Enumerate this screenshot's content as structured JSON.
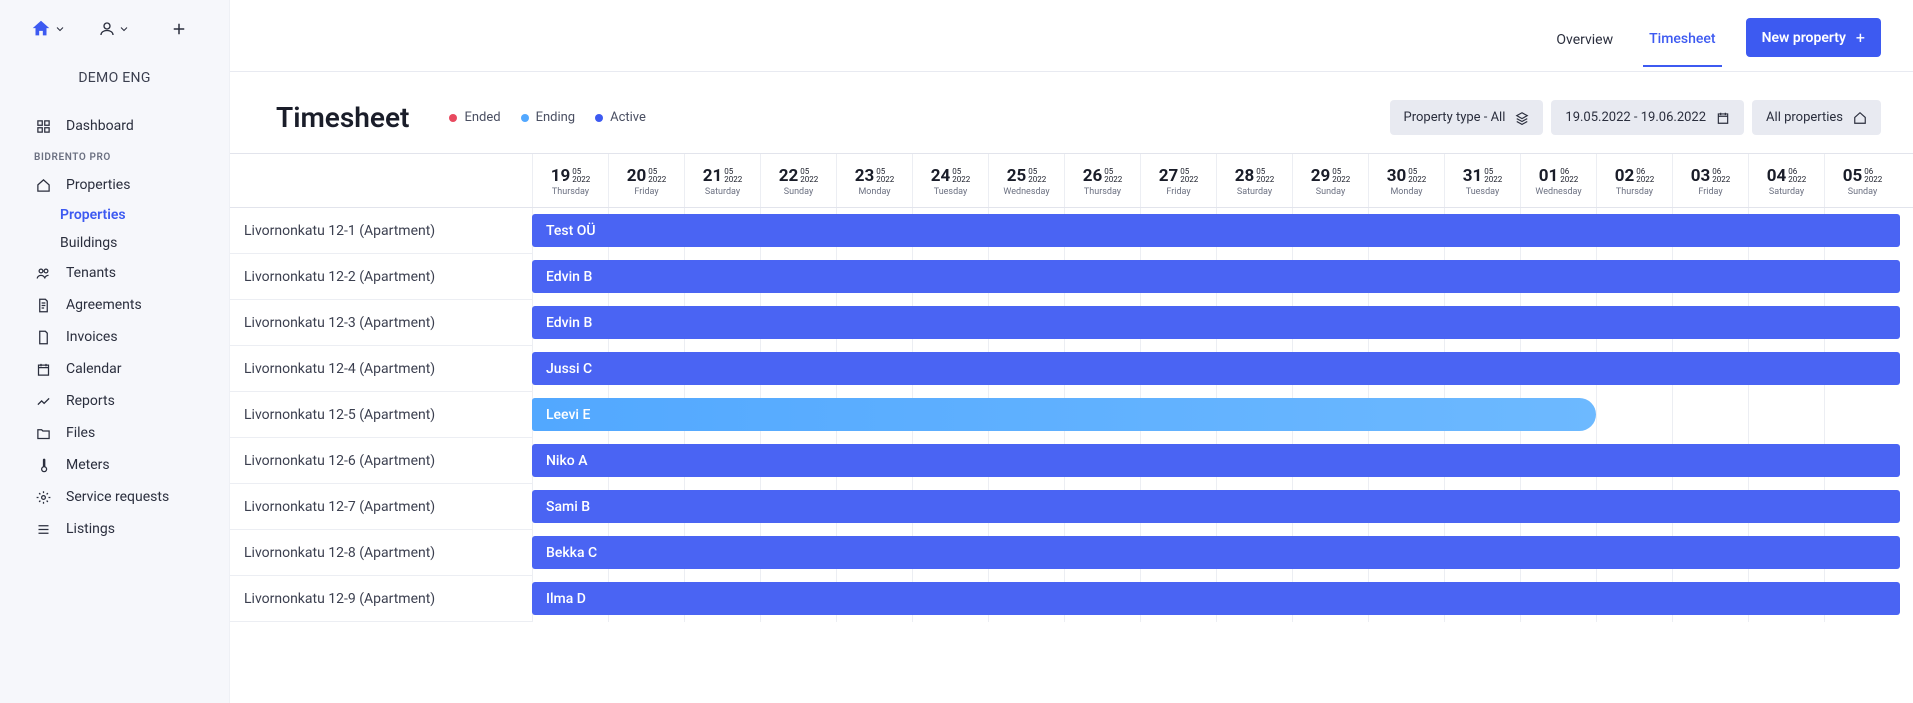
{
  "org": {
    "name": "DEMO ENG"
  },
  "sidebar": {
    "section_label": "BIDRENTO PRO",
    "dashboard": "Dashboard",
    "properties": "Properties",
    "properties_sub": "Properties",
    "buildings_sub": "Buildings",
    "tenants": "Tenants",
    "agreements": "Agreements",
    "invoices": "Invoices",
    "calendar": "Calendar",
    "reports": "Reports",
    "files": "Files",
    "meters": "Meters",
    "service": "Service requests",
    "listings": "Listings"
  },
  "topbar": {
    "overview": "Overview",
    "timesheet": "Timesheet",
    "new_property": "New property"
  },
  "page": {
    "title": "Timesheet",
    "legend": {
      "ended": "Ended",
      "ending": "Ending",
      "active": "Active"
    }
  },
  "filters": {
    "property_type": "Property type - All",
    "date_range": "19.05.2022 - 19.06.2022",
    "all_properties": "All properties"
  },
  "dates": [
    {
      "d": "19",
      "m": "05",
      "y": "2022",
      "dow": "Thursday"
    },
    {
      "d": "20",
      "m": "05",
      "y": "2022",
      "dow": "Friday"
    },
    {
      "d": "21",
      "m": "05",
      "y": "2022",
      "dow": "Saturday"
    },
    {
      "d": "22",
      "m": "05",
      "y": "2022",
      "dow": "Sunday"
    },
    {
      "d": "23",
      "m": "05",
      "y": "2022",
      "dow": "Monday"
    },
    {
      "d": "24",
      "m": "05",
      "y": "2022",
      "dow": "Tuesday"
    },
    {
      "d": "25",
      "m": "05",
      "y": "2022",
      "dow": "Wednesday"
    },
    {
      "d": "26",
      "m": "05",
      "y": "2022",
      "dow": "Thursday"
    },
    {
      "d": "27",
      "m": "05",
      "y": "2022",
      "dow": "Friday"
    },
    {
      "d": "28",
      "m": "05",
      "y": "2022",
      "dow": "Saturday"
    },
    {
      "d": "29",
      "m": "05",
      "y": "2022",
      "dow": "Sunday"
    },
    {
      "d": "30",
      "m": "05",
      "y": "2022",
      "dow": "Monday"
    },
    {
      "d": "31",
      "m": "05",
      "y": "2022",
      "dow": "Tuesday"
    },
    {
      "d": "01",
      "m": "06",
      "y": "2022",
      "dow": "Wednesday"
    },
    {
      "d": "02",
      "m": "06",
      "y": "2022",
      "dow": "Thursday"
    },
    {
      "d": "03",
      "m": "06",
      "y": "2022",
      "dow": "Friday"
    },
    {
      "d": "04",
      "m": "06",
      "y": "2022",
      "dow": "Saturday"
    },
    {
      "d": "05",
      "m": "06",
      "y": "2022",
      "dow": "Sunday"
    }
  ],
  "rows": [
    {
      "label": "Livornonkatu 12-1 (Apartment)",
      "tenant": "Test OÜ",
      "status": "active",
      "span": 18
    },
    {
      "label": "Livornonkatu 12-2 (Apartment)",
      "tenant": "Edvin B",
      "status": "active",
      "span": 18
    },
    {
      "label": "Livornonkatu 12-3 (Apartment)",
      "tenant": "Edvin B",
      "status": "active",
      "span": 18
    },
    {
      "label": "Livornonkatu 12-4 (Apartment)",
      "tenant": "Jussi C",
      "status": "active",
      "span": 18
    },
    {
      "label": "Livornonkatu 12-5 (Apartment)",
      "tenant": "Leevi E",
      "status": "ending",
      "span": 14
    },
    {
      "label": "Livornonkatu 12-6 (Apartment)",
      "tenant": "Niko A",
      "status": "active",
      "span": 18
    },
    {
      "label": "Livornonkatu 12-7 (Apartment)",
      "tenant": "Sami B",
      "status": "active",
      "span": 18
    },
    {
      "label": "Livornonkatu 12-8 (Apartment)",
      "tenant": "Bekka C",
      "status": "active",
      "span": 18
    },
    {
      "label": "Livornonkatu 12-9 (Apartment)",
      "tenant": "Ilma D",
      "status": "active",
      "span": 18
    }
  ],
  "colors": {
    "primary": "#3d5af1",
    "ending": "#52a8ff",
    "ended": "#e8495f"
  }
}
